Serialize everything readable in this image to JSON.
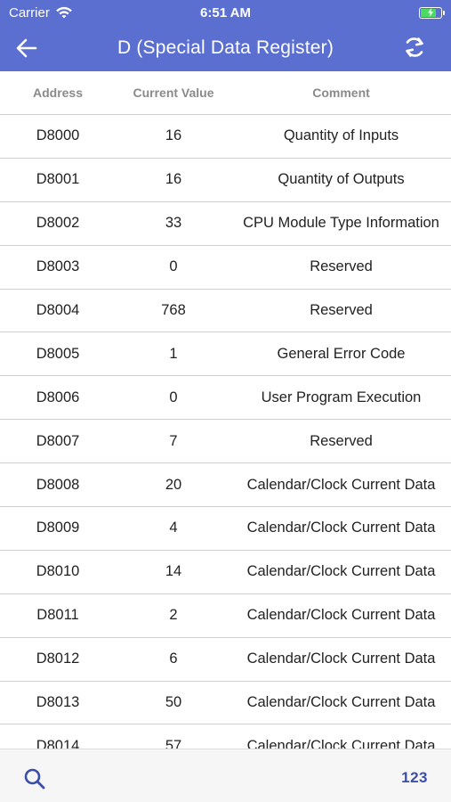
{
  "status_bar": {
    "carrier": "Carrier",
    "time": "6:51 AM"
  },
  "nav": {
    "title": "D (Special Data Register)"
  },
  "table": {
    "headers": {
      "address": "Address",
      "current_value": "Current Value",
      "comment": "Comment"
    },
    "rows": [
      {
        "address": "D8000",
        "value": "16",
        "comment": "Quantity of Inputs"
      },
      {
        "address": "D8001",
        "value": "16",
        "comment": "Quantity of Outputs"
      },
      {
        "address": "D8002",
        "value": "33",
        "comment": "CPU Module Type Information"
      },
      {
        "address": "D8003",
        "value": "0",
        "comment": "Reserved"
      },
      {
        "address": "D8004",
        "value": "768",
        "comment": "Reserved"
      },
      {
        "address": "D8005",
        "value": "1",
        "comment": "General Error Code"
      },
      {
        "address": "D8006",
        "value": "0",
        "comment": "User Program Execution"
      },
      {
        "address": "D8007",
        "value": "7",
        "comment": "Reserved"
      },
      {
        "address": "D8008",
        "value": "20",
        "comment": "Calendar/Clock Current Data"
      },
      {
        "address": "D8009",
        "value": "4",
        "comment": "Calendar/Clock Current Data"
      },
      {
        "address": "D8010",
        "value": "14",
        "comment": "Calendar/Clock Current Data"
      },
      {
        "address": "D8011",
        "value": "2",
        "comment": "Calendar/Clock Current Data"
      },
      {
        "address": "D8012",
        "value": "6",
        "comment": "Calendar/Clock Current Data"
      },
      {
        "address": "D8013",
        "value": "50",
        "comment": "Calendar/Clock Current Data"
      },
      {
        "address": "D8014",
        "value": "57",
        "comment": "Calendar/Clock Current Data"
      }
    ]
  },
  "toolbar": {
    "numeric_label": "123"
  },
  "colors": {
    "header_bg": "#5b6fd0",
    "toolbar_accent": "#3b4fa8",
    "battery": "#4cd964"
  },
  "icons": {
    "back": "arrow-left-icon",
    "refresh": "refresh-icon",
    "search": "search-icon",
    "wifi": "wifi-icon",
    "battery": "battery-charging-icon"
  }
}
